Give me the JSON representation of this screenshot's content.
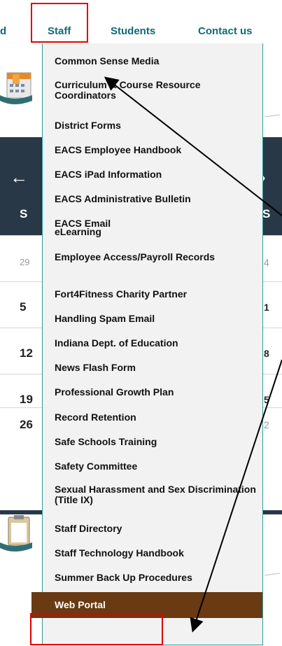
{
  "nav": {
    "prev_label": "d",
    "staff_label": "Staff",
    "students_label": "Students",
    "contact_label": "Contact us"
  },
  "calendar": {
    "header_letter": "S",
    "header_right": "S",
    "rows": [
      {
        "left": "29",
        "right": "4",
        "muted": true
      },
      {
        "left": "5",
        "right": "1",
        "muted": false
      },
      {
        "left": "12",
        "right": "8",
        "muted": false
      },
      {
        "left": "19",
        "right": "5",
        "muted": false
      },
      {
        "left": "26",
        "right": "2",
        "muted": false
      }
    ]
  },
  "dropdown": {
    "items": [
      "Common Sense Media",
      "Curriculum & Course Resource Coordinators",
      "District Forms",
      "EACS Employee Handbook",
      "EACS iPad Information",
      "EACS Administrative Bulletin",
      "EACS Email",
      "eLearning",
      "Employee Access/Payroll Records",
      "Fort4Fitness Charity Partner",
      "Handling Spam Email",
      "Indiana Dept. of Education",
      "News Flash Form",
      "Professional Growth Plan",
      "Record Retention",
      "Safe Schools Training",
      "Safety Committee",
      "Sexual Harassment and Sex Discrimination (Title IX)",
      "Staff Directory",
      "Staff Technology Handbook",
      "Summer Back Up Procedures"
    ],
    "active_item": "Web Portal"
  },
  "colors": {
    "nav_text": "#0e6b74",
    "highlight_box": "#e00000",
    "active_bg": "#6a3a12",
    "dropdown_border": "#2a9a9a",
    "calendar_header": "#283847"
  }
}
